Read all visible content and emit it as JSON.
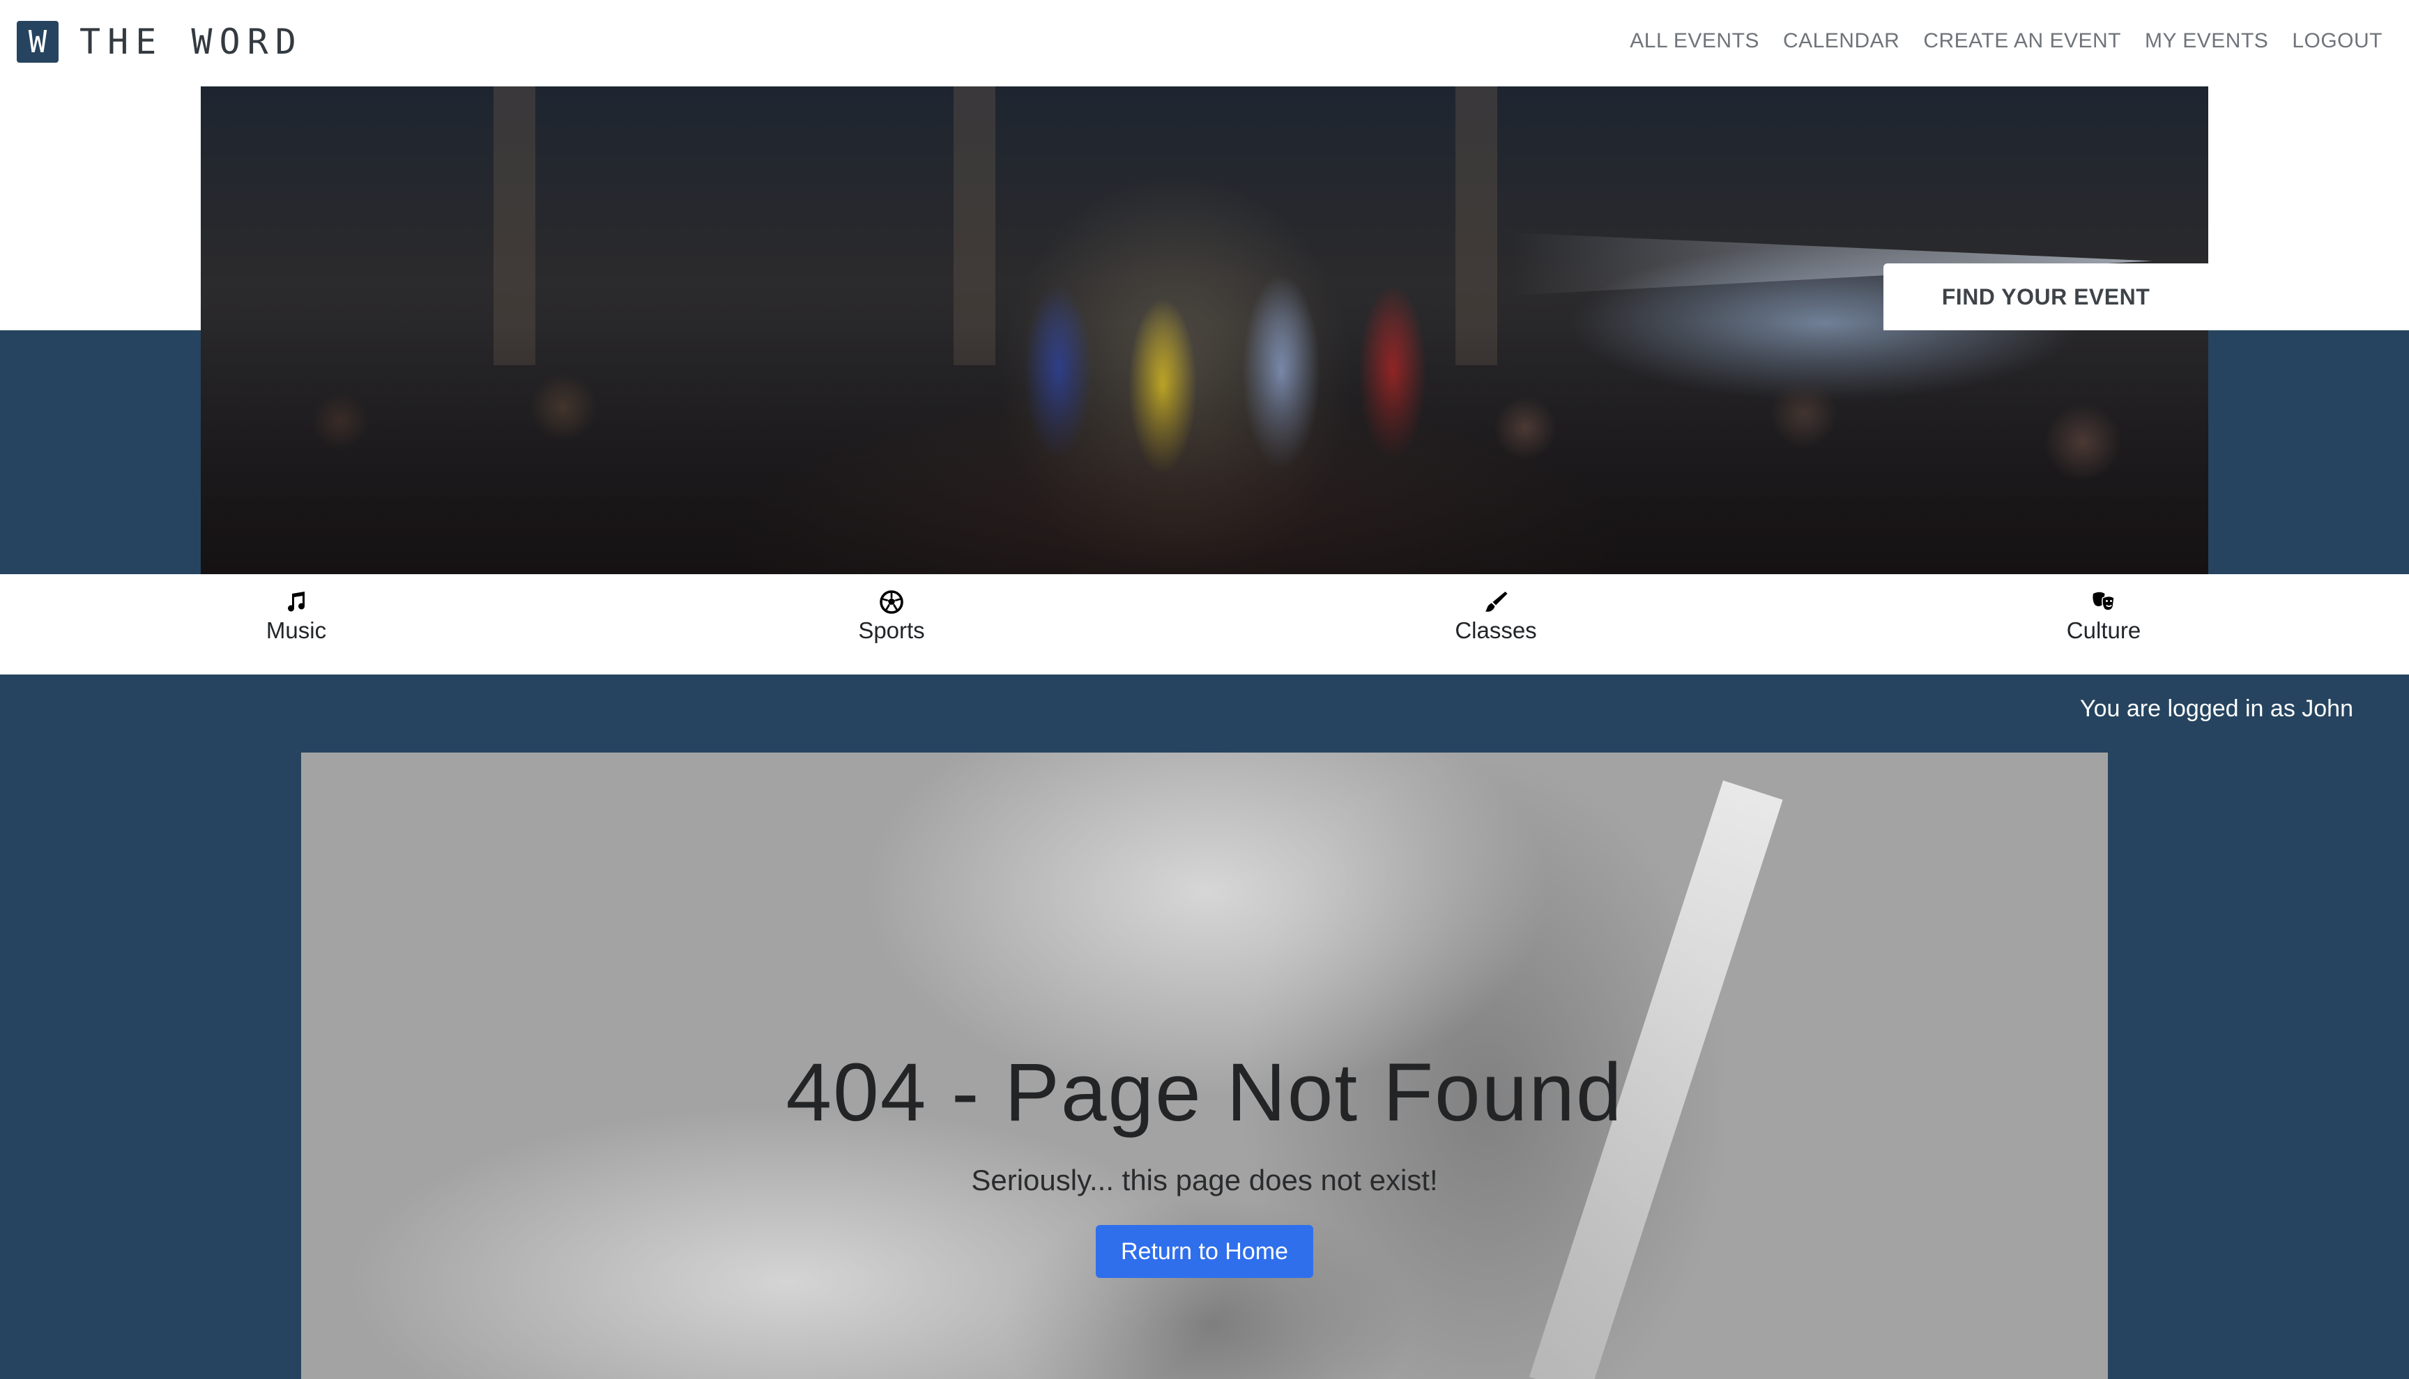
{
  "brand": {
    "badge": "W",
    "name": "THE WORD"
  },
  "nav": {
    "items": [
      {
        "label": "ALL EVENTS"
      },
      {
        "label": "CALENDAR"
      },
      {
        "label": "CREATE AN EVENT"
      },
      {
        "label": "MY EVENTS"
      },
      {
        "label": "LOGOUT"
      }
    ]
  },
  "hero": {
    "find_button": "FIND YOUR EVENT"
  },
  "categories": [
    {
      "label": "Music",
      "icon": "music-note-icon"
    },
    {
      "label": "Sports",
      "icon": "soccer-ball-icon"
    },
    {
      "label": "Classes",
      "icon": "paintbrush-icon"
    },
    {
      "label": "Culture",
      "icon": "theater-masks-icon"
    }
  ],
  "status": {
    "logged_in": "You are logged in as John"
  },
  "error": {
    "title": "404 - Page Not Found",
    "subtitle": "Seriously... this page does not exist!",
    "button": "Return to Home"
  },
  "colors": {
    "primary_dark": "#26445f",
    "button_blue": "#2f6fec",
    "nav_text": "#6f747a",
    "panel_gray": "#a3a3a3"
  }
}
